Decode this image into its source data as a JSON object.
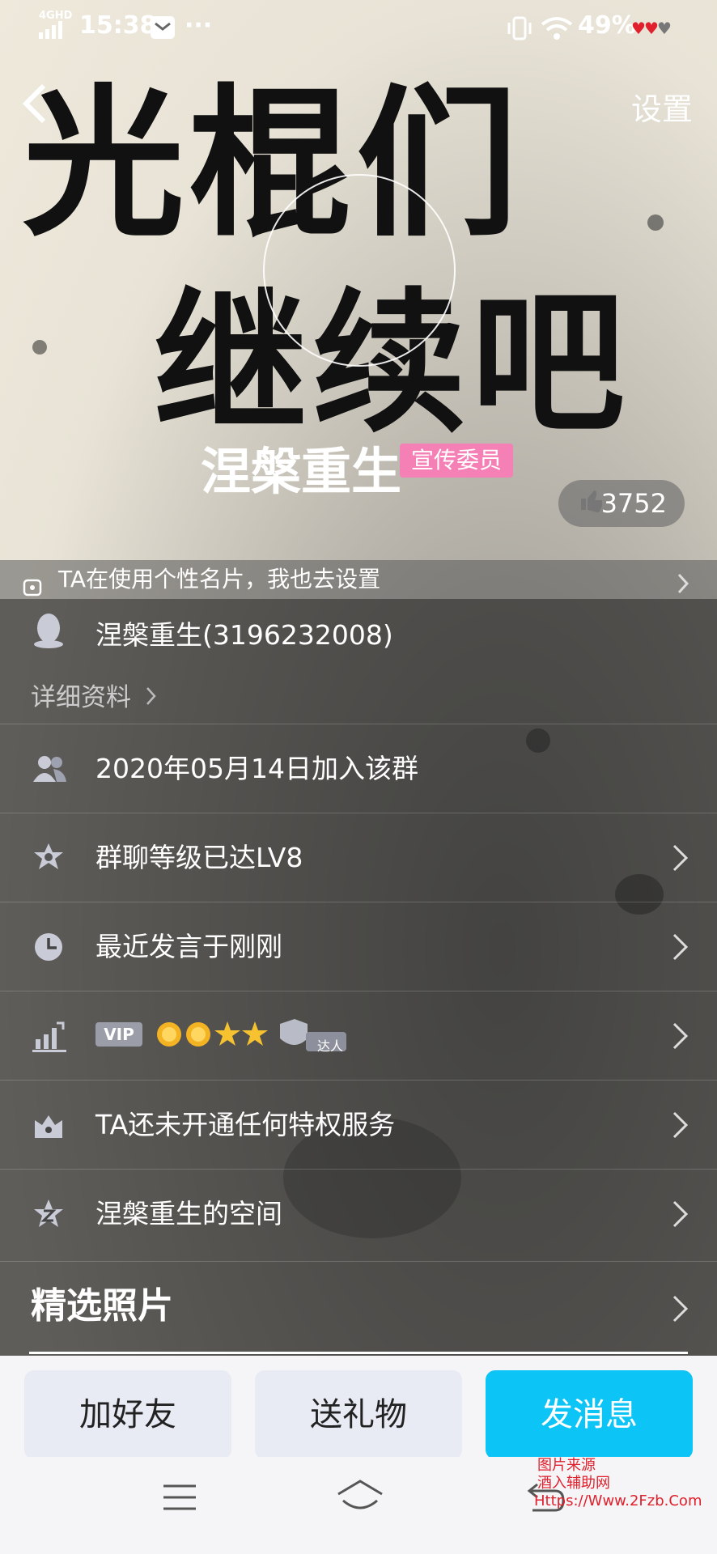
{
  "status_bar": {
    "network": "4GHD",
    "time": "15:38",
    "battery": "49%",
    "icons": [
      "signal-icon",
      "mail-icon",
      "more-dots-icon",
      "vibrate-icon",
      "wifi-icon",
      "battery-hearts-icon"
    ]
  },
  "top_bar": {
    "settings_label": "设置"
  },
  "cover": {
    "calligraphy_line1": "光棍们",
    "calligraphy_line2": "继续吧"
  },
  "profile": {
    "nickname": "涅槃重生",
    "role_badge": "宣传委员",
    "likes": "3752"
  },
  "namecard_tip": "TA在使用个性名片，我也去设置",
  "info": {
    "qq_line": "涅槃重生(3196232008)",
    "details_link": "详细资料"
  },
  "rows": [
    {
      "label": "2020年05月14日加入该群",
      "icon": "group-members-icon",
      "has_chevron": false
    },
    {
      "label": "群聊等级已达LV8",
      "icon": "star-badge-icon",
      "has_chevron": true
    },
    {
      "label": "最近发言于刚刚",
      "icon": "clock-icon",
      "has_chevron": true
    },
    {
      "label": "",
      "icon": "rank-chart-icon",
      "has_chevron": true
    },
    {
      "label": "TA还未开通任何特权服务",
      "icon": "crown-icon",
      "has_chevron": true
    },
    {
      "label": "涅槃重生的空间",
      "icon": "qzone-icon",
      "has_chevron": true
    }
  ],
  "level_row": {
    "vip_badge": "VIP",
    "suns": 2,
    "stars": 2,
    "talent_label": "达人"
  },
  "photos": {
    "title": "精选照片"
  },
  "actions": {
    "add_friend": "加好友",
    "send_gift": "送礼物",
    "send_message": "发消息"
  },
  "colors": {
    "accent": "#0dc4f6",
    "badge_pink": "#f580b5",
    "button_light": "#e8ebf4"
  },
  "watermark": {
    "line1": "图片来源",
    "line2": "酒入辅助网",
    "line3": "Https://Www.2Fzb.Com"
  }
}
